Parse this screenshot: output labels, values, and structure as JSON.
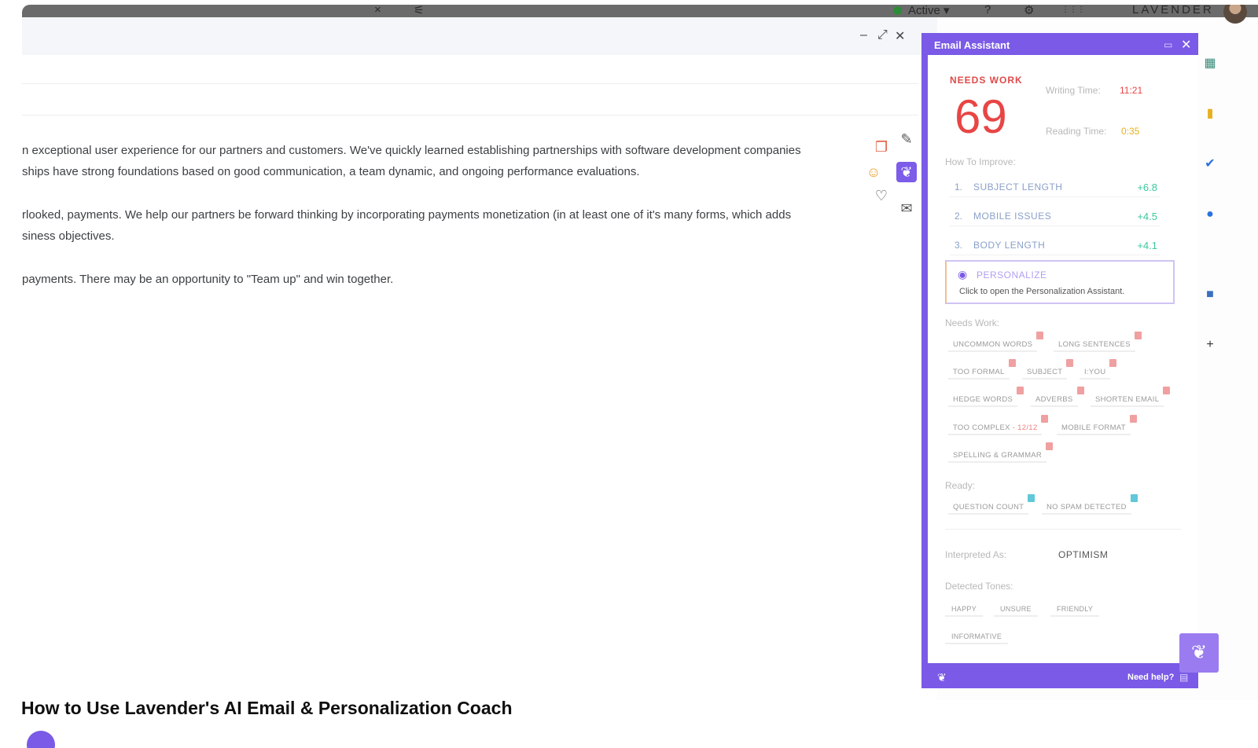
{
  "topbar": {
    "close_icon": "×",
    "settings_icon": "⚟",
    "status_label": "Active ▾",
    "help_icon": "?",
    "gear_icon": "⚙",
    "apps_icon": "⋮⋮⋮",
    "brand": "LAVENDER"
  },
  "compose": {
    "minimize_icon": "–",
    "expand_icon": "⤢",
    "close_icon": "✕",
    "body_lines": [
      "n exceptional user experience for our partners and customers. We've quickly learned establishing partnerships with software development companies",
      "ships have strong foundations based on good communication, a team dynamic, and ongoing performance evaluations.",
      "rlooked, payments. We help our partners be forward thinking by incorporating payments monetization (in at least one of it's many forms, which adds",
      "siness objectives.",
      "payments. There may be an opportunity to \"Team up\" and win together."
    ]
  },
  "assistant": {
    "title": "Email Assistant",
    "status": "NEEDS WORK",
    "score": "69",
    "writing_time_label": "Writing Time:",
    "writing_time": "11:21",
    "reading_time_label": "Reading Time:",
    "reading_time": "0:35",
    "how_to_improve_label": "How To Improve:",
    "improvements": [
      {
        "num": "1.",
        "name": "SUBJECT LENGTH",
        "gain": "+6.8"
      },
      {
        "num": "2.",
        "name": "MOBILE ISSUES",
        "gain": "+4.5"
      },
      {
        "num": "3.",
        "name": "BODY LENGTH",
        "gain": "+4.1"
      }
    ],
    "personalize_title": "PERSONALIZE",
    "personalize_desc": "Click to open the Personalization Assistant.",
    "needs_work_label": "Needs Work:",
    "needs_work_chips": [
      "UNCOMMON WORDS",
      "LONG SENTENCES",
      "TOO FORMAL",
      "SUBJECT",
      "I:YOU",
      "HEDGE WORDS",
      "ADVERBS",
      "SHORTEN EMAIL",
      "TOO COMPLEX",
      "MOBILE FORMAT",
      "SPELLING & GRAMMAR"
    ],
    "too_complex_sub": " - 12/12",
    "ready_label": "Ready:",
    "ready_chips": [
      "QUESTION COUNT",
      "NO SPAM DETECTED"
    ],
    "interpreted_label": "Interpreted As:",
    "interpreted_value": "OPTIMISM",
    "tones_label": "Detected Tones:",
    "tones": [
      "HAPPY",
      "UNSURE",
      "FRIENDLY",
      "INFORMATIVE"
    ],
    "need_help": "Need help?"
  },
  "video": {
    "title": "How to Use Lavender's AI Email & Personalization Coach"
  },
  "colors": {
    "lavender": "#7a5ae6",
    "score_red": "#e84545",
    "gain_green": "#3cc8a0"
  }
}
